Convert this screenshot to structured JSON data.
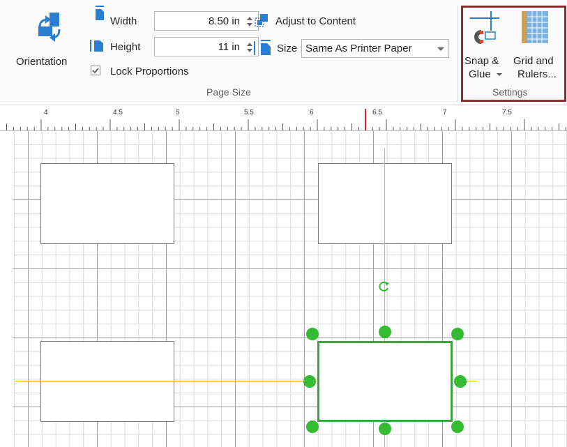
{
  "ribbon": {
    "orientation_label": "Orientation",
    "width_label": "Width",
    "width_value": "8.50 in",
    "height_label": "Height",
    "height_value": "11 in",
    "lock_proportions_label": "Lock Proportions",
    "lock_proportions_checked": true,
    "adjust_to_content_label": "Adjust to Content",
    "size_label": "Size",
    "size_value": "Same As Printer Paper",
    "page_size_caption": "Page Size",
    "snap_glue_line1": "Snap &",
    "snap_glue_line2": "Glue",
    "grid_rulers_line1": "Grid and",
    "grid_rulers_line2": "Rulers...",
    "settings_caption": "Settings"
  },
  "ruler": {
    "labels": [
      "4",
      "4.5",
      "5",
      "5.5",
      "6",
      "6.5",
      "7",
      "7.5"
    ],
    "marker_color": "#e0232d"
  },
  "canvas": {
    "shape_count": 4,
    "selected_shape_index": 3,
    "selection_color": "#33bb33",
    "guide_color": "#f5b800"
  }
}
